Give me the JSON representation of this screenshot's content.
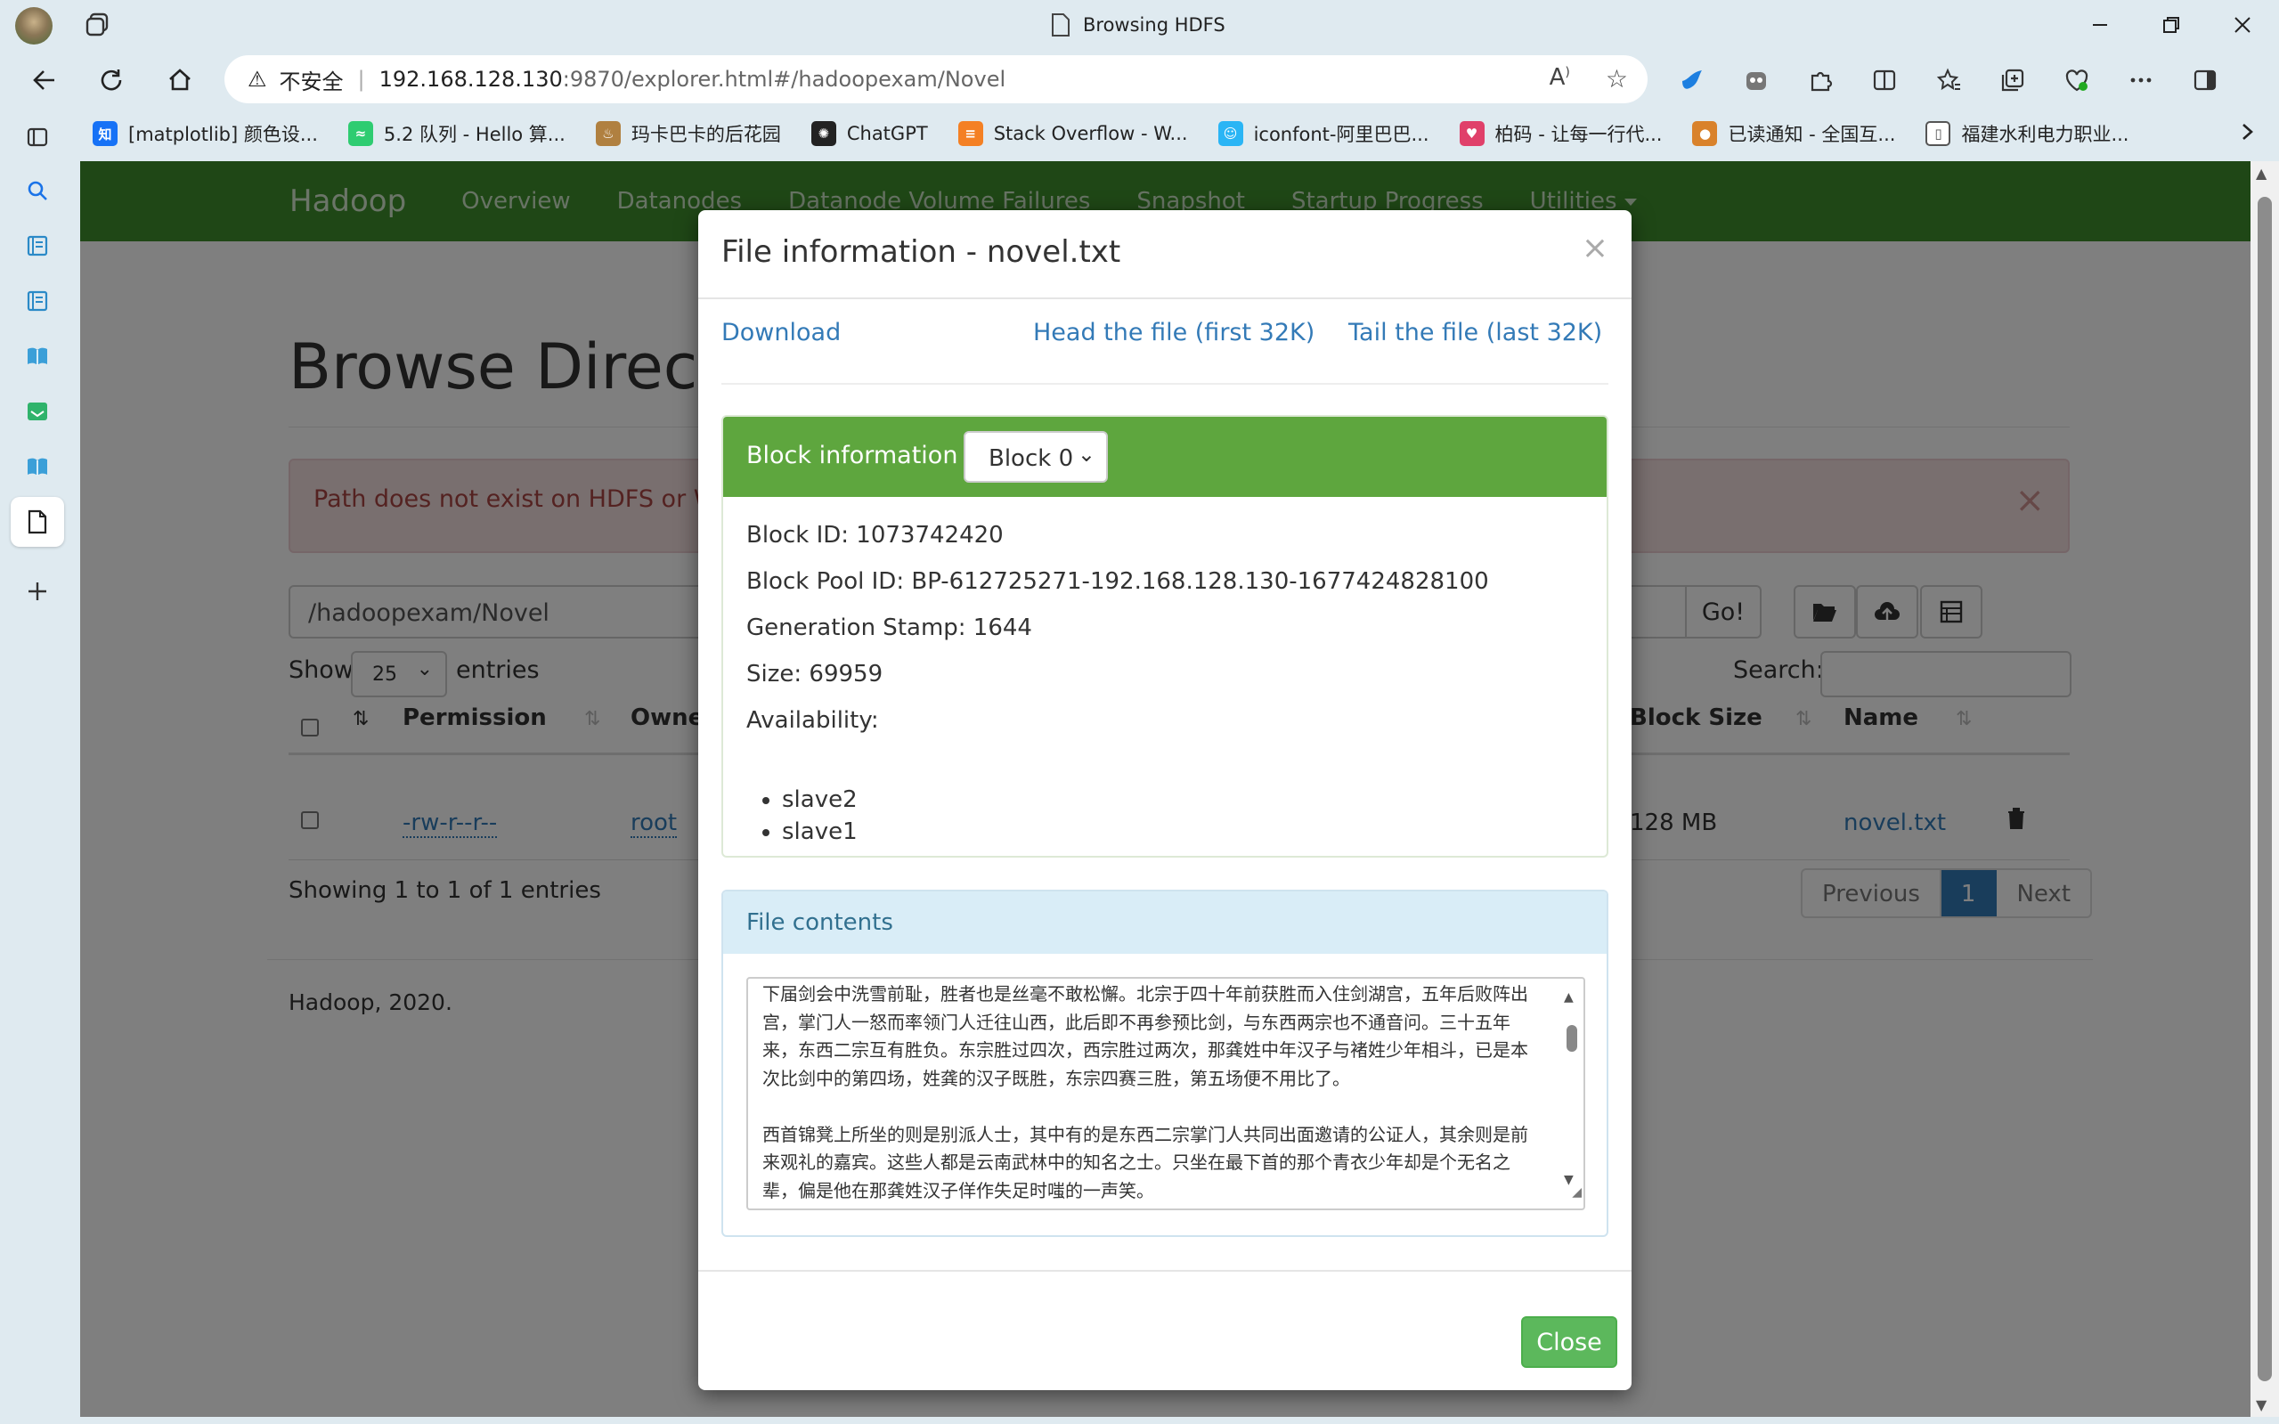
{
  "window": {
    "title": "Browsing HDFS"
  },
  "address_bar": {
    "security_label": "不安全",
    "url_host": "192.168.128.130",
    "url_rest": ":9870/explorer.html#/hadoopexam/Novel"
  },
  "bookmarks": [
    {
      "icon": "zhihu-icon",
      "label": "[matplotlib] 颜色设...",
      "color": "#1772f6",
      "glyph": "知"
    },
    {
      "icon": "leetcode-icon",
      "label": "5.2  队列 - Hello 算...",
      "color": "#2ecc71",
      "glyph": "≈"
    },
    {
      "icon": "tea-icon",
      "label": "玛卡巴卡的后花园",
      "color": "#b08040",
      "glyph": "♨"
    },
    {
      "icon": "chatgpt-icon",
      "label": "ChatGPT",
      "color": "#222222",
      "glyph": "✺"
    },
    {
      "icon": "stackoverflow-icon",
      "label": "Stack Overflow - W...",
      "color": "#f48024",
      "glyph": "≡"
    },
    {
      "icon": "iconfont-icon",
      "label": "iconfont-阿里巴巴...",
      "color": "#2ab5f5",
      "glyph": "☺"
    },
    {
      "icon": "bocode-icon",
      "label": "柏码 - 让每一行代...",
      "color": "#e0406a",
      "glyph": "♥"
    },
    {
      "icon": "notice-icon",
      "label": "已读通知 - 全国互...",
      "color": "#d9822b",
      "glyph": "●"
    },
    {
      "icon": "file-icon",
      "label": "福建水利电力职业...",
      "color": "#666666",
      "glyph": "▯"
    }
  ],
  "hadoop_nav": {
    "brand": "Hadoop",
    "links": [
      "Overview",
      "Datanodes",
      "Datanode Volume Failures",
      "Snapshot",
      "Startup Progress",
      "Utilities"
    ]
  },
  "page": {
    "heading": "Browse Directory",
    "alert": "Path does not exist on HDFS or WebHDFS is disabled.",
    "path_value": "/hadoopexam/Novel",
    "go_label": "Go!",
    "show_label": "Show",
    "entries_label": "entries",
    "entries_value": "25",
    "search_label": "Search:",
    "columns": [
      "Permission",
      "Owner",
      "Block Size",
      "Name"
    ],
    "row": {
      "permission": "-rw-r--r--",
      "owner": "root",
      "block_size": "128 MB",
      "name": "novel.txt"
    },
    "showing": "Showing 1 to 1 of 1 entries",
    "pager": {
      "prev": "Previous",
      "current": "1",
      "next": "Next"
    },
    "footer": "Hadoop, 2020."
  },
  "modal": {
    "title": "File information - novel.txt",
    "close_x": "×",
    "download": "Download",
    "head": "Head the file (first 32K)",
    "tail": "Tail the file (last 32K)",
    "block_info_label": "Block information --",
    "block_selected": "Block 0",
    "block_id": "Block ID: 1073742420",
    "block_pool_id": "Block Pool ID: BP-612725271-192.168.128.130-1677424828100",
    "generation_stamp": "Generation Stamp: 1644",
    "size": "Size: 69959",
    "availability_label": "Availability:",
    "availability": [
      "slave2",
      "slave1"
    ],
    "file_contents_label": "File contents",
    "contents_p1": "下届剑会中洗雪前耻，胜者也是丝毫不敢松懈。北宗于四十年前获胜而入住剑湖宫，五年后败阵出宫，掌门人一怒而率领门人迁往山西，此后即不再参预比剑，与东西两宗也不通音问。三十五年来，东西二宗互有胜负。东宗胜过四次，西宗胜过两次，那龚姓中年汉子与褚姓少年相斗，已是本次比剑中的第四场，姓龚的汉子既胜，东宗四赛三胜，第五场便不用比了。",
    "contents_p2": "西首锦凳上所坐的则是别派人士，其中有的是东西二宗掌门人共同出面邀请的公证人，其余则是前来观礼的嘉宾。这些人都是云南武林中的知名之士。只坐在最下首的那个青衣少年却是个无名之辈，偏是他在那龚姓汉子佯作失足时嗤的一声笑。",
    "close_button": "Close"
  }
}
